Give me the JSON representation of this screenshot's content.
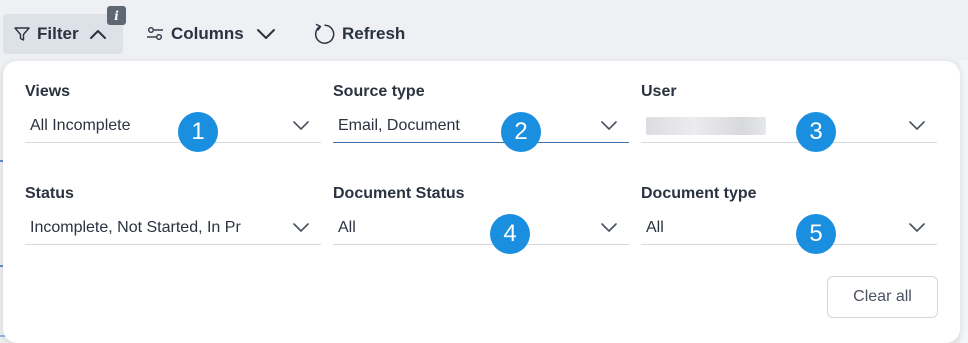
{
  "toolbar": {
    "filter_label": "Filter",
    "info_badge": "i",
    "columns_label": "Columns",
    "refresh_label": "Refresh"
  },
  "filters": {
    "views": {
      "label": "Views",
      "value": "All Incomplete"
    },
    "source_type": {
      "label": "Source type",
      "value": "Email, Document"
    },
    "user": {
      "label": "User",
      "value": ""
    },
    "status": {
      "label": "Status",
      "value": "Incomplete, Not Started, In Pr"
    },
    "document_status": {
      "label": "Document Status",
      "value": "All"
    },
    "document_type": {
      "label": "Document type",
      "value": "All"
    }
  },
  "steps": [
    "1",
    "2",
    "3",
    "4",
    "5"
  ],
  "clear_all_label": "Clear all",
  "colors": {
    "step_badge": "#1a8fe0",
    "active_underline": "#3f6fb0",
    "filter_button_bg": "#dde1e8"
  }
}
